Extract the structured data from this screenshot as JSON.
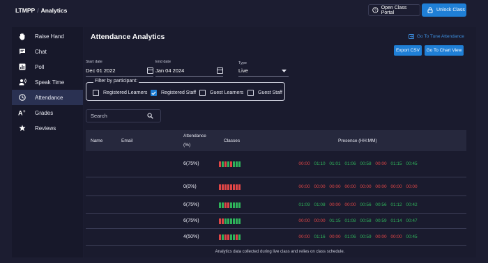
{
  "topbar": {
    "breadcrumb_course": "LTMPP",
    "breadcrumb_separator": "/",
    "breadcrumb_page": "Analytics",
    "open_portal_label": "Open Class Portal",
    "unlock_label": "Unlock Class"
  },
  "sidebar": {
    "items": [
      {
        "label": "Raise Hand",
        "icon": "hand-icon"
      },
      {
        "label": "Chat",
        "icon": "chat-icon"
      },
      {
        "label": "Poll",
        "icon": "poll-icon"
      },
      {
        "label": "Speak Time",
        "icon": "speak-icon"
      },
      {
        "label": "Attendance",
        "icon": "clock-icon",
        "active": true
      },
      {
        "label": "Grades",
        "icon": "grades-icon"
      },
      {
        "label": "Reviews",
        "icon": "star-icon"
      }
    ]
  },
  "main": {
    "title": "Attendance Analytics",
    "tune_link": "Go To Tune Attendance",
    "export_label": "Export CSV",
    "chart_view_label": "Go To Chart View",
    "start_date_label": "Start date",
    "start_date_value": "Dec 01 2022",
    "end_date_label": "End date",
    "end_date_value": "Jan 04 2024",
    "type_label": "Type",
    "type_value": "Live",
    "filter_legend": "Filter by participant:",
    "filters": [
      {
        "label": "Registered Learners",
        "checked": false
      },
      {
        "label": "Registered Staff",
        "checked": true
      },
      {
        "label": "Guest Learners",
        "checked": false
      },
      {
        "label": "Guest Staff",
        "checked": false
      }
    ],
    "search_placeholder": "Search",
    "columns": {
      "name": "Name",
      "email": "Email",
      "attendance_line1": "Attendance",
      "attendance_line2": "(%)",
      "classes": "Classes",
      "presence": "Presence (HH:MM)"
    },
    "rows": [
      {
        "attendance": "6(75%)",
        "classes": [
          "r",
          "g",
          "r",
          "g",
          "r",
          "g",
          "g",
          "g"
        ],
        "presence": [
          "00:00",
          "01:10",
          "01:01",
          "01:06",
          "00:58",
          "00:00",
          "01:15",
          "00:45"
        ]
      },
      {
        "attendance": "0(0%)",
        "classes": [
          "r",
          "r",
          "r",
          "r",
          "r",
          "r",
          "r",
          "r"
        ],
        "presence": [
          "00:00",
          "00:00",
          "00:00",
          "00:00",
          "00:00",
          "00:00",
          "00:00",
          "00:00"
        ]
      },
      {
        "attendance": "6(75%)",
        "classes": [
          "g",
          "g",
          "r",
          "r",
          "g",
          "g",
          "g",
          "g"
        ],
        "presence": [
          "01:09",
          "01:08",
          "00:00",
          "00:00",
          "00:56",
          "00:56",
          "01:12",
          "00:42"
        ]
      },
      {
        "attendance": "6(75%)",
        "classes": [
          "r",
          "r",
          "g",
          "g",
          "g",
          "g",
          "g",
          "g"
        ],
        "presence": [
          "00:00",
          "00:00",
          "01:15",
          "01:08",
          "00:58",
          "00:59",
          "01:14",
          "00:47"
        ]
      },
      {
        "attendance": "4(50%)",
        "classes": [
          "r",
          "g",
          "r",
          "r",
          "g",
          "g",
          "r",
          "g"
        ],
        "presence": [
          "00:00",
          "01:16",
          "00:00",
          "01:06",
          "00:59",
          "00:00",
          "00:00",
          "00:45"
        ]
      }
    ],
    "footer_note": "Analytics data collected during live class and relies on class schedule."
  },
  "colors": {
    "present": "#2fb35a",
    "absent": "#e04646",
    "accent": "#1f7fd6"
  }
}
